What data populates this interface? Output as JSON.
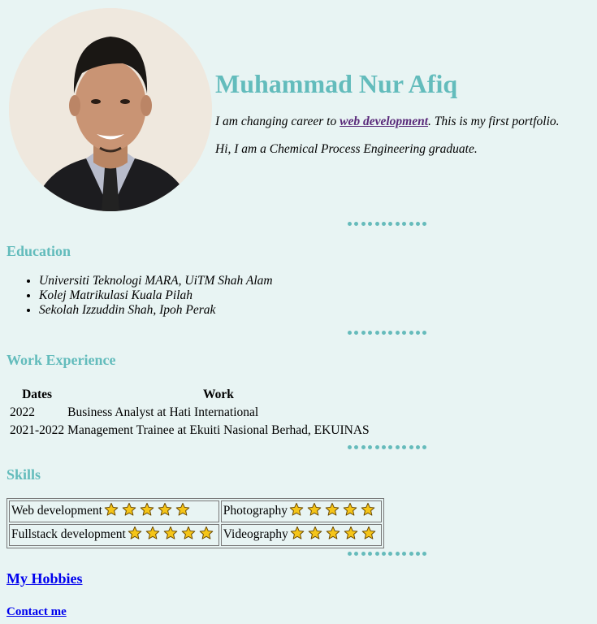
{
  "profile": {
    "name": "Muhammad Nur Afiq",
    "intro_prefix": "I am changing career to ",
    "intro_link": "web development",
    "intro_suffix": ". This is my first portfolio.",
    "intro_line2": "Hi, I am a Chemical Process Engineering graduate."
  },
  "education": {
    "heading": "Education",
    "items": [
      "Universiti Teknologi MARA, UiTM Shah Alam",
      "Kolej Matrikulasi Kuala Pilah",
      "Sekolah Izzuddin Shah, Ipoh Perak"
    ]
  },
  "work": {
    "heading": "Work Experience",
    "col_dates": "Dates",
    "col_work": "Work",
    "rows": [
      {
        "dates": "2022",
        "work": "Business Analyst at Hati International"
      },
      {
        "dates": "2021-2022",
        "work": "Management Trainee at Ekuiti Nasional Berhad, EKUINAS"
      }
    ]
  },
  "skills": {
    "heading": "Skills",
    "rows": [
      [
        {
          "name": "Web development",
          "stars": 5
        },
        {
          "name": "Photography",
          "stars": 5
        }
      ],
      [
        {
          "name": "Fullstack development",
          "stars": 5
        },
        {
          "name": "Videography",
          "stars": 5
        }
      ]
    ]
  },
  "links": {
    "hobbies": "My Hobbies",
    "contact": "Contact me"
  },
  "colors": {
    "accent": "#63bcbc",
    "background": "#e8f4f3",
    "link": "#0000ee",
    "visited_link": "#5a2a7a",
    "star": "#f5c518"
  }
}
